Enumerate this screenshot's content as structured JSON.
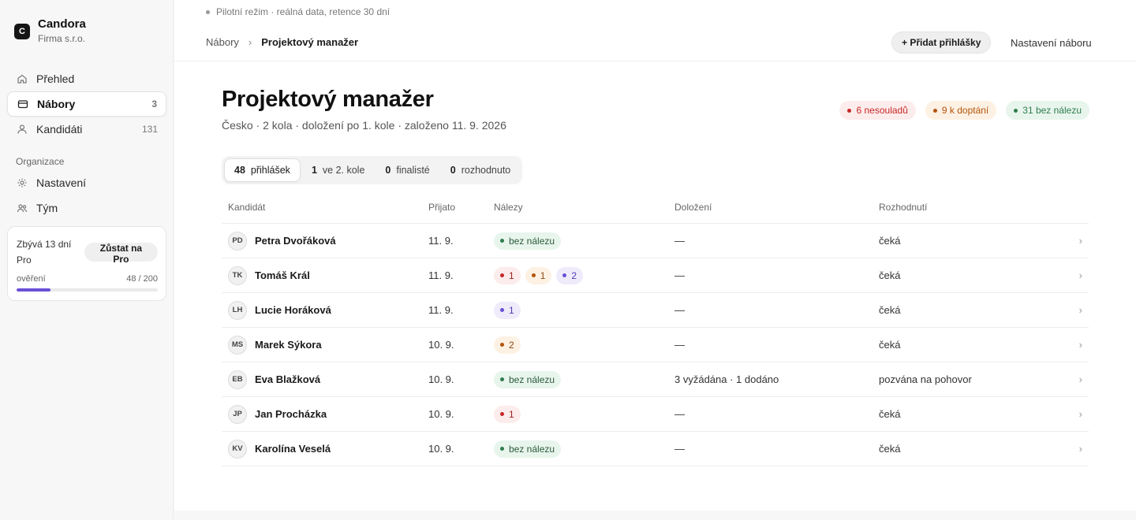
{
  "sidebar": {
    "brand": {
      "logo_letter": "C",
      "name": "Candora",
      "company": "Firma s.r.o."
    },
    "nav": [
      {
        "label": "Přehled",
        "icon": "home-icon",
        "count": ""
      },
      {
        "label": "Nábory",
        "icon": "folder-icon",
        "count": "3",
        "active": true
      },
      {
        "label": "Kandidáti",
        "icon": "person-icon",
        "count": "131"
      }
    ],
    "section_label": "Organizace",
    "org_nav": [
      {
        "label": "Nastavení",
        "icon": "gear-icon"
      },
      {
        "label": "Tým",
        "icon": "team-icon"
      }
    ],
    "trial": {
      "text": "Zbývá 13 dní Pro",
      "button": "Zůstat na Pro",
      "meter_label": "ověření",
      "meter_value": "48 / 200",
      "meter_fraction": 0.24,
      "meter_color": "#6a4fd8"
    }
  },
  "header": {
    "pilot_notice": "Pilotní režim · reálná data, retence 30 dní",
    "breadcrumb": {
      "parent": "Nábory",
      "separator": "›",
      "current": "Projektový manažer"
    },
    "add_button": "+ Přidat přihlášky",
    "settings_button": "Nastavení náboru"
  },
  "job": {
    "title": "Projektový manažer",
    "subtitle": "Česko · 2 kola · doložení po 1. kole · založeno 11. 9. 2026",
    "summary_chips": [
      {
        "label": "6 nesouladů",
        "color": "#c62828",
        "bg": "#fdecec"
      },
      {
        "label": "9 k doptání",
        "color": "#b45309",
        "bg": "#fdf1e4"
      },
      {
        "label": "31 bez nálezu",
        "color": "#2e7d4f",
        "bg": "#e8f5ec"
      }
    ]
  },
  "tabs": [
    {
      "count": "48",
      "label": "přihlášek",
      "active": true
    },
    {
      "count": "1",
      "label": "ve 2. kole"
    },
    {
      "count": "0",
      "label": "finalisté"
    },
    {
      "count": "0",
      "label": "rozhodnuto"
    }
  ],
  "table": {
    "columns": [
      "Kandidát",
      "Přijato",
      "Nálezy",
      "Doložení",
      "Rozhodnutí"
    ],
    "rows": [
      {
        "initials": "PD",
        "name": "Petra Dvořáková",
        "received": "11. 9.",
        "findings": [
          {
            "label": "bez nálezu",
            "type": "green"
          }
        ],
        "docs": "—",
        "decision": "čeká"
      },
      {
        "initials": "TK",
        "name": "Tomáš Král",
        "received": "11. 9.",
        "findings": [
          {
            "label": "1",
            "type": "red"
          },
          {
            "label": "1",
            "type": "orange"
          },
          {
            "label": "2",
            "type": "purple"
          }
        ],
        "docs": "—",
        "decision": "čeká"
      },
      {
        "initials": "LH",
        "name": "Lucie Horáková",
        "received": "11. 9.",
        "findings": [
          {
            "label": "1",
            "type": "purple"
          }
        ],
        "docs": "—",
        "decision": "čeká"
      },
      {
        "initials": "MS",
        "name": "Marek Sýkora",
        "received": "10. 9.",
        "findings": [
          {
            "label": "2",
            "type": "orange"
          }
        ],
        "docs": "—",
        "decision": "čeká"
      },
      {
        "initials": "EB",
        "name": "Eva Blažková",
        "received": "10. 9.",
        "findings": [
          {
            "label": "bez nálezu",
            "type": "green"
          }
        ],
        "docs": "3 vyžádána · 1 dodáno",
        "decision": "pozvána na pohovor"
      },
      {
        "initials": "JP",
        "name": "Jan Procházka",
        "received": "10. 9.",
        "findings": [
          {
            "label": "1",
            "type": "red"
          }
        ],
        "docs": "—",
        "decision": "čeká"
      },
      {
        "initials": "KV",
        "name": "Karolína Veselá",
        "received": "10. 9.",
        "findings": [
          {
            "label": "bez nálezu",
            "type": "green"
          }
        ],
        "docs": "—",
        "decision": "čeká"
      }
    ],
    "row_chevron": "›",
    "pill_styles": {
      "green": {
        "color": "#2e7d4f",
        "bg": "#e8f5ec",
        "text": "#2b5a3c"
      },
      "red": {
        "color": "#c62828",
        "bg": "#fdecec",
        "text": "#9b2020"
      },
      "orange": {
        "color": "#b45309",
        "bg": "#fdf1e4",
        "text": "#8a4a12"
      },
      "purple": {
        "color": "#6a4fd8",
        "bg": "#efebfb",
        "text": "#4f3bb0"
      }
    }
  }
}
